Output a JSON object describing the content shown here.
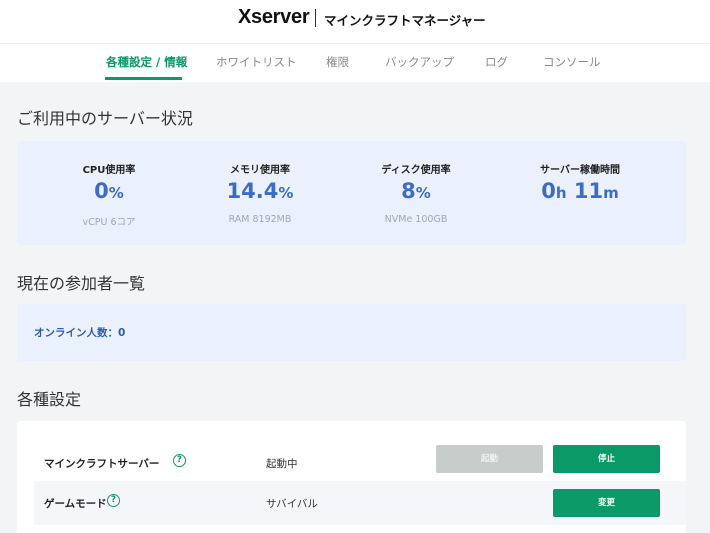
{
  "header": {
    "logo": "Xserver",
    "app_title": "マインクラフトマネージャー"
  },
  "tabs": [
    {
      "label": "各種設定 / 情報",
      "active": true
    },
    {
      "label": "ホワイトリスト",
      "active": false
    },
    {
      "label": "権限",
      "active": false
    },
    {
      "label": "バックアップ",
      "active": false
    },
    {
      "label": "ログ",
      "active": false
    },
    {
      "label": "コンソール",
      "active": false
    }
  ],
  "server_status": {
    "title": "ご利用中のサーバー状況",
    "stats": [
      {
        "label": "CPU使用率",
        "value": "0",
        "unit": "%",
        "sub": "vCPU 6コア"
      },
      {
        "label": "メモリ使用率",
        "value": "14.4",
        "unit": "%",
        "sub": "RAM 8192MB"
      },
      {
        "label": "ディスク使用率",
        "value": "8",
        "unit": "%",
        "sub": "NVMe 100GB"
      },
      {
        "label": "サーバー稼働時間",
        "hours": "0",
        "hours_unit": "h",
        "minutes": "11",
        "minutes_unit": "m"
      }
    ]
  },
  "participants": {
    "title": "現在の参加者一覧",
    "online_label": "オンライン人数：0"
  },
  "settings": {
    "title": "各種設定",
    "rows": [
      {
        "label": "マインクラフトサーバー",
        "value": "起動中",
        "start_button": "起動",
        "stop_button": "停止"
      },
      {
        "label": "ゲームモード",
        "value": "サバイバル",
        "change_button": "変更"
      }
    ]
  },
  "colors": {
    "accent": "#0a9a67",
    "stat_value": "#3d6cc4",
    "panel_bg": "#eaf1fc"
  }
}
